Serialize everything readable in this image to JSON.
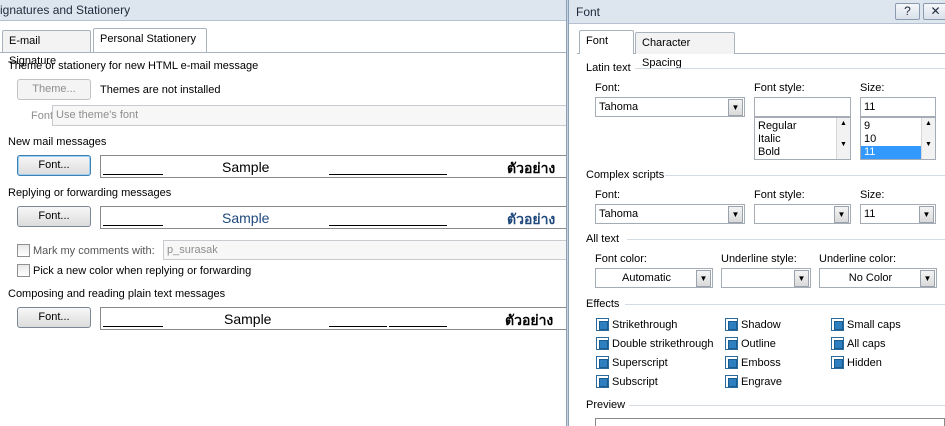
{
  "left": {
    "title": "Signatures and Stationery",
    "tabs": [
      {
        "label": "E-mail Signature"
      },
      {
        "label": "Personal Stationery"
      }
    ],
    "theme_section": {
      "heading": "Theme or stationery for new HTML e-mail message",
      "theme_button": "Theme...",
      "theme_status": "Themes are not installed",
      "font_label": "Font:",
      "font_value": "Use theme's font"
    },
    "new_mail": {
      "heading": "New mail messages",
      "font_button": "Font...",
      "sample": "Sample",
      "thai_sample": "ตัวอย่าง"
    },
    "reply": {
      "heading": "Replying or forwarding messages",
      "font_button": "Font...",
      "sample": "Sample",
      "thai_sample": "ตัวอย่าง",
      "sample_color": "#1f497d"
    },
    "mark_comments": {
      "label": "Mark my comments with:",
      "value": "p_surasak",
      "checked": false
    },
    "pick_color": {
      "label": "Pick a new color when replying or forwarding",
      "checked": false
    },
    "plain_text": {
      "heading": "Composing and reading plain text messages",
      "font_button": "Font...",
      "sample": "Sample",
      "thai_sample": "ตัวอย่าง"
    }
  },
  "right": {
    "title": "Font",
    "help_button": "?",
    "close_button": "✕",
    "tabs": [
      {
        "label": "Font"
      },
      {
        "label": "Character Spacing"
      }
    ],
    "latin": {
      "heading": "Latin text",
      "font_label": "Font:",
      "font_value": "Tahoma",
      "style_label": "Font style:",
      "style_value": "",
      "style_options": [
        "Regular",
        "Italic",
        "Bold"
      ],
      "size_label": "Size:",
      "size_value": "11",
      "size_options": [
        "9",
        "10",
        "11"
      ],
      "size_selected": "11"
    },
    "complex": {
      "heading": "Complex scripts",
      "font_label": "Font:",
      "font_value": "Tahoma",
      "style_label": "Font style:",
      "style_value": "",
      "size_label": "Size:",
      "size_value": "11"
    },
    "all_text": {
      "heading": "All text",
      "color_label": "Font color:",
      "color_value": "Automatic",
      "underline_label": "Underline style:",
      "underline_value": "",
      "underline_color_label": "Underline color:",
      "underline_color_value": "No Color"
    },
    "effects": {
      "heading": "Effects",
      "items": [
        {
          "label": "Strikethrough",
          "checked": true
        },
        {
          "label": "Double strikethrough",
          "checked": true
        },
        {
          "label": "Superscript",
          "checked": true
        },
        {
          "label": "Subscript",
          "checked": true
        },
        {
          "label": "Shadow",
          "checked": true
        },
        {
          "label": "Outline",
          "checked": true
        },
        {
          "label": "Emboss",
          "checked": true
        },
        {
          "label": "Engrave",
          "checked": true
        },
        {
          "label": "Small caps",
          "checked": true
        },
        {
          "label": "All caps",
          "checked": true
        },
        {
          "label": "Hidden",
          "checked": true
        }
      ]
    },
    "preview": {
      "heading": "Preview"
    }
  },
  "colors": {
    "accent": "#3399ff",
    "checkbox_fill": "#2e7fbf",
    "titlebar": "#dde5ef"
  }
}
